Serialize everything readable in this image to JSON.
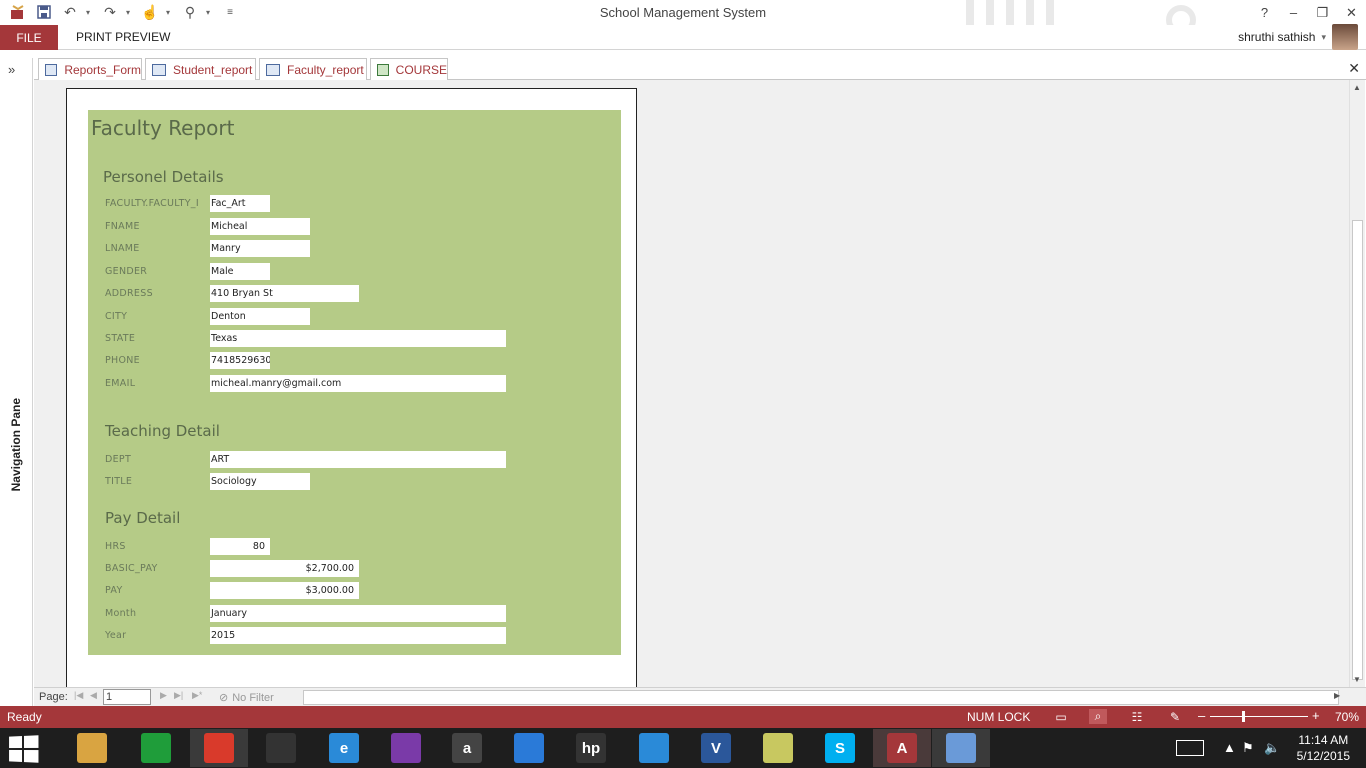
{
  "titlebar": {
    "title": "School Management System",
    "help": "?",
    "minimize": "–",
    "restore": "❐",
    "close": "✕"
  },
  "ribbon": {
    "file_tab": "FILE",
    "print_preview_tab": "PRINT PREVIEW",
    "user_name": "shruthi sathish",
    "user_menu": "▾"
  },
  "nav_pane": {
    "toggle": "»",
    "label": "Navigation Pane"
  },
  "doc_tabs": [
    {
      "label": "Reports_Form",
      "icon": "form-icon"
    },
    {
      "label": "Student_report",
      "icon": "report-icon"
    },
    {
      "label": "Faculty_report",
      "icon": "report-icon"
    },
    {
      "label": "COURSE",
      "icon": "table-icon"
    }
  ],
  "doc_close": "✕",
  "report": {
    "title": "Faculty Report",
    "sections": {
      "personal": "Personel Details",
      "teaching": "Teaching Detail",
      "pay": "Pay Detail"
    },
    "fields": [
      {
        "label": "FACULTY.FACULTY_I",
        "value": "Fac_Art"
      },
      {
        "label": "FNAME",
        "value": "Micheal"
      },
      {
        "label": "LNAME",
        "value": "Manry"
      },
      {
        "label": "GENDER",
        "value": "Male"
      },
      {
        "label": "ADDRESS",
        "value": "410 Bryan St"
      },
      {
        "label": "CITY",
        "value": "Denton"
      },
      {
        "label": "STATE",
        "value": "Texas"
      },
      {
        "label": "PHONE",
        "value": "7418529630"
      },
      {
        "label": "EMAIL",
        "value": "micheal.manry@gmail.com"
      },
      {
        "label": "DEPT",
        "value": "ART"
      },
      {
        "label": "TITLE",
        "value": "Sociology"
      },
      {
        "label": "HRS",
        "value": "80"
      },
      {
        "label": "BASIC_PAY",
        "value": "$2,700.00"
      },
      {
        "label": "PAY",
        "value": "$3,000.00"
      },
      {
        "label": "Month",
        "value": "January"
      },
      {
        "label": "Year",
        "value": "2015"
      }
    ]
  },
  "record_nav": {
    "page_label": "Page:",
    "page_value": "1",
    "filter_label": "No Filter"
  },
  "status": {
    "ready": "Ready",
    "num_lock": "NUM LOCK",
    "zoom_minus": "–",
    "zoom_plus": "+",
    "zoom": "70%",
    "zoom_level_percent": 70
  },
  "taskbar": {
    "time": "11:14 AM",
    "date": "5/12/2015",
    "apps": [
      {
        "name": "file-explorer-icon",
        "glyph": "",
        "color": "#d9a441"
      },
      {
        "name": "store-icon",
        "glyph": "",
        "color": "#1f9d3a"
      },
      {
        "name": "chrome-icon",
        "glyph": "",
        "color": "#d93a2b"
      },
      {
        "name": "camera-app-icon",
        "glyph": "",
        "color": "#333333"
      },
      {
        "name": "internet-explorer-icon",
        "glyph": "e",
        "color": "#2a8ad8"
      },
      {
        "name": "puzzle-app-icon",
        "glyph": "",
        "color": "#7a3aa8"
      },
      {
        "name": "amazon-icon",
        "glyph": "a",
        "color": "#444444"
      },
      {
        "name": "onedrive-icon",
        "glyph": "",
        "color": "#2a7ad8"
      },
      {
        "name": "hp-icon",
        "glyph": "hp",
        "color": "#333333"
      },
      {
        "name": "chat-app-icon",
        "glyph": "",
        "color": "#2a8ad8"
      },
      {
        "name": "visio-icon",
        "glyph": "V",
        "color": "#2b579a"
      },
      {
        "name": "sticky-notes-icon",
        "glyph": "",
        "color": "#c8c860"
      },
      {
        "name": "skype-icon",
        "glyph": "S",
        "color": "#00aff0"
      },
      {
        "name": "access-icon",
        "glyph": "A",
        "color": "#a4373a"
      },
      {
        "name": "paint-icon",
        "glyph": "",
        "color": "#6a9ad8"
      }
    ]
  }
}
